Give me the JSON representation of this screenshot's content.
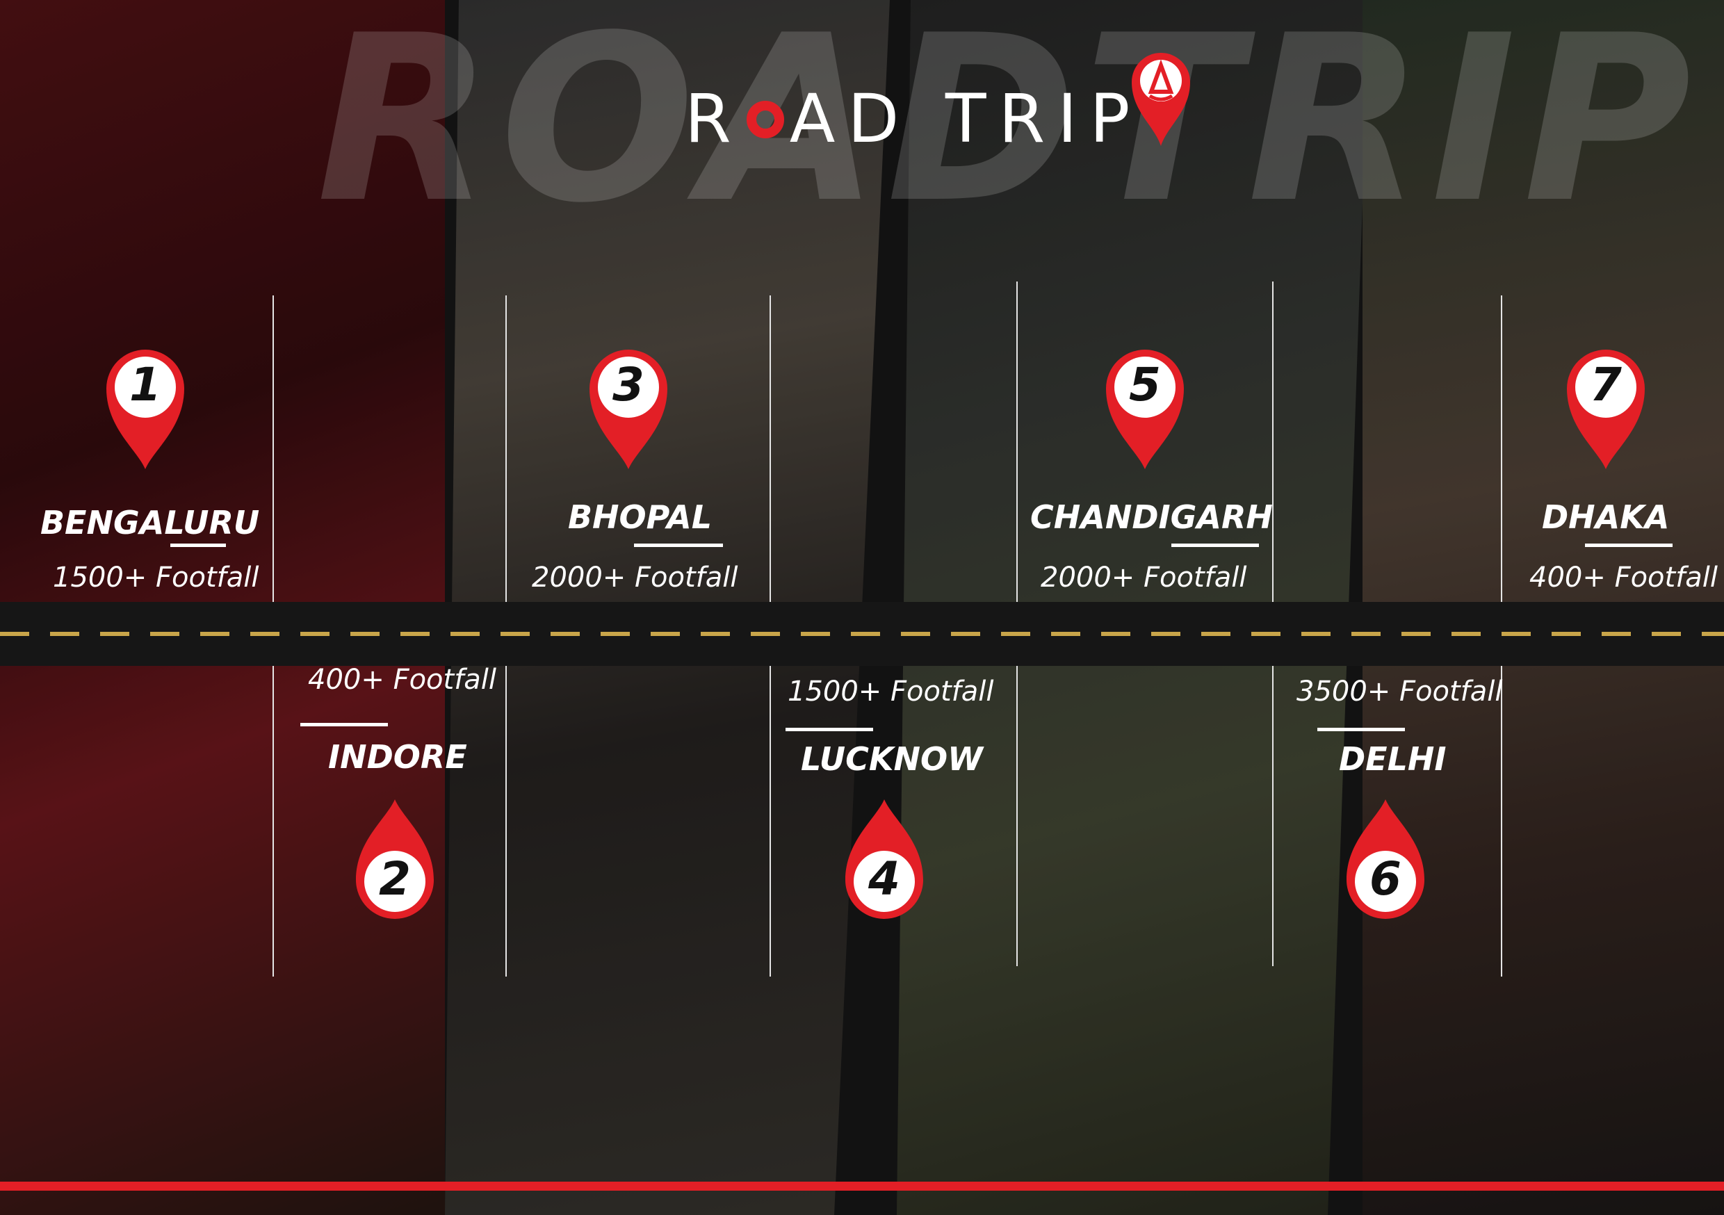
{
  "title": {
    "left": "R",
    "right": "AD TRIP"
  },
  "watermark": "ROADTRIP",
  "colors": {
    "accent": "#e31f26",
    "road": "#161616",
    "road_dash": "#c9a54a",
    "text": "#ffffff"
  },
  "stops": [
    {
      "number": "1",
      "city": "BENGALURU",
      "footfall": "1500+ Footfall"
    },
    {
      "number": "2",
      "city": "INDORE",
      "footfall": "400+ Footfall"
    },
    {
      "number": "3",
      "city": "BHOPAL",
      "footfall": "2000+   Footfall"
    },
    {
      "number": "4",
      "city": "LUCKNOW",
      "footfall": "1500+   Footfall"
    },
    {
      "number": "5",
      "city": "CHANDIGARH",
      "footfall": "2000+   Footfall"
    },
    {
      "number": "6",
      "city": "DELHI",
      "footfall": "3500+ Footfall"
    },
    {
      "number": "7",
      "city": "DHAKA",
      "footfall": "400+ Footfall"
    }
  ],
  "icons": {
    "map_pin": "map-pin-icon",
    "logo": "roadtrip-logo-pin-icon"
  }
}
